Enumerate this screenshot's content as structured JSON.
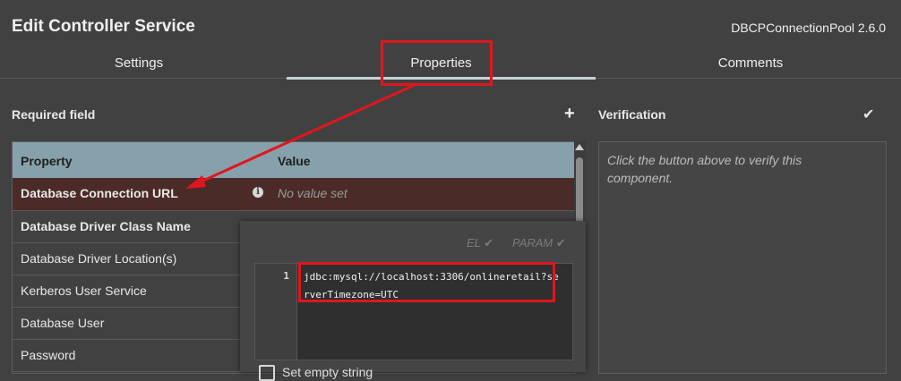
{
  "header": {
    "title": "Edit Controller Service",
    "service_type": "DBCPConnectionPool 2.6.0"
  },
  "tabs": [
    {
      "label": "Settings",
      "active": false
    },
    {
      "label": "Properties",
      "active": true
    },
    {
      "label": "Comments",
      "active": false
    }
  ],
  "properties_panel": {
    "required_label": "Required field",
    "add_icon": "plus-icon",
    "columns": {
      "property": "Property",
      "value": "Value"
    },
    "rows": [
      {
        "name": "Database Connection URL",
        "value": "No value set",
        "required": true,
        "selected": true,
        "info_icon": "info-icon"
      },
      {
        "name": "Database Driver Class Name",
        "value": "",
        "required": true
      },
      {
        "name": "Database Driver Location(s)",
        "value": "",
        "required": false
      },
      {
        "name": "Kerberos User Service",
        "value": "",
        "required": false
      },
      {
        "name": "Database User",
        "value": "",
        "required": false
      },
      {
        "name": "Password",
        "value": "",
        "required": false
      }
    ]
  },
  "verification": {
    "label": "Verification",
    "check_icon": "checkmark-icon",
    "message": "Click the button above to verify this component."
  },
  "editor": {
    "el_label": "EL",
    "param_label": "PARAM",
    "line_number": "1",
    "code": "jdbc:mysql://localhost:3306/onlineretail?serverTimezone=UTC",
    "set_empty_label": "Set empty string"
  },
  "colors": {
    "annotation": "#e0161e",
    "header_row": "#86a1ac",
    "selected_row": "#4a2b27",
    "background": "#414141"
  }
}
